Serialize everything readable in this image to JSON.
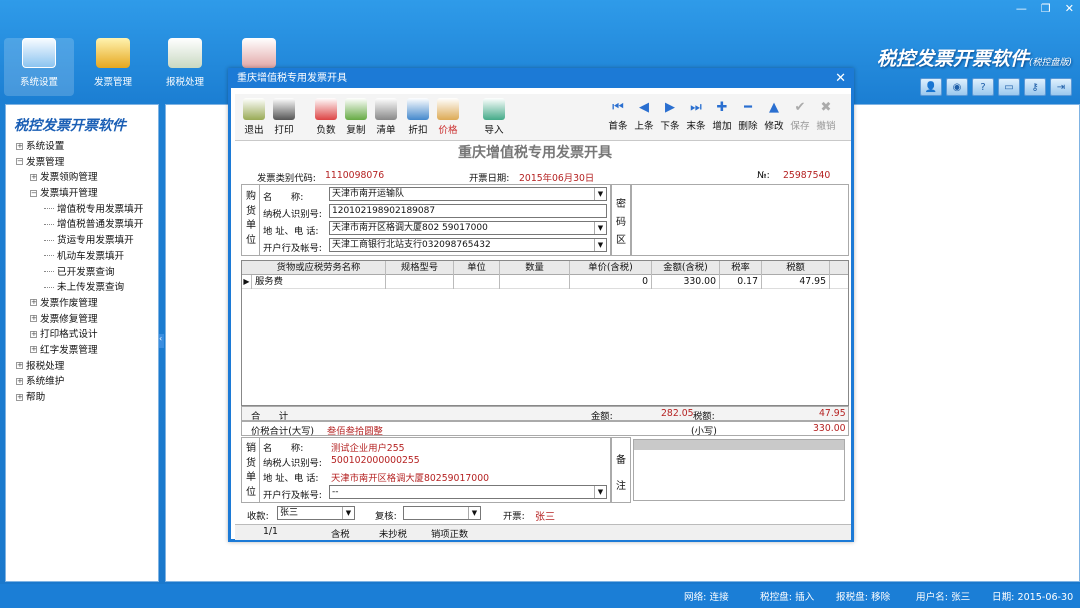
{
  "top": {
    "tools": [
      {
        "label": "系统设置",
        "active": true
      },
      {
        "label": "发票管理"
      },
      {
        "label": "报税处理"
      }
    ],
    "brand": "税控发票开票软件",
    "brand_sub": "(税控盘版)"
  },
  "sidebar": {
    "title": "税控发票开票软件",
    "tree": [
      {
        "label": "系统设置",
        "lvl": 0,
        "t": "+"
      },
      {
        "label": "发票管理",
        "lvl": 0,
        "t": "-"
      },
      {
        "label": "发票领购管理",
        "lvl": 1,
        "t": "+"
      },
      {
        "label": "发票填开管理",
        "lvl": 1,
        "t": "-"
      },
      {
        "label": "增值税专用发票填开",
        "lvl": 2
      },
      {
        "label": "增值税普通发票填开",
        "lvl": 2
      },
      {
        "label": "货运专用发票填开",
        "lvl": 2
      },
      {
        "label": "机动车发票填开",
        "lvl": 2
      },
      {
        "label": "已开发票查询",
        "lvl": 2
      },
      {
        "label": "未上传发票查询",
        "lvl": 2
      },
      {
        "label": "发票作废管理",
        "lvl": 1,
        "t": "+"
      },
      {
        "label": "发票修复管理",
        "lvl": 1,
        "t": "+"
      },
      {
        "label": "打印格式设计",
        "lvl": 1,
        "t": "+"
      },
      {
        "label": "红字发票管理",
        "lvl": 1,
        "t": "+"
      },
      {
        "label": "报税处理",
        "lvl": 0,
        "t": "+"
      },
      {
        "label": "系统维护",
        "lvl": 0,
        "t": "+"
      },
      {
        "label": "帮助",
        "lvl": 0,
        "t": "+"
      }
    ]
  },
  "dialog": {
    "title": "重庆增值税专用发票开具",
    "toolbar_left": [
      "退出",
      "打印",
      "负数",
      "复制",
      "清单",
      "折扣",
      "价格",
      "导入"
    ],
    "toolbar_right": [
      "首条",
      "上条",
      "下条",
      "末条",
      "增加",
      "删除",
      "修改",
      "保存",
      "撤销"
    ],
    "form_title": "重庆增值税专用发票开具",
    "code_label": "发票类别代码:",
    "code": "1110098076",
    "date_label": "开票日期:",
    "date": "2015年06月30日",
    "no_label": "№:",
    "no": "25987540",
    "buyer_label": "购货单位",
    "buyer": {
      "name_label": "名　　称:",
      "name": "天津市南开运输队",
      "tax_label": "纳税人识别号:",
      "tax": "120102198902189087",
      "addr_label": "地 址、电 话:",
      "addr": "天津市南开区格调大厦802  59017000",
      "bank_label": "开户行及帐号:",
      "bank": "天津工商银行北站支行032098765432"
    },
    "secret_label": "密码区",
    "grid": {
      "headers": [
        "货物或应税劳务名称",
        "规格型号",
        "单位",
        "数量",
        "单价(含税)",
        "金额(含税)",
        "税率",
        "税额"
      ],
      "row": [
        "服务费",
        "",
        "",
        "",
        "0",
        "330.00",
        "0.17",
        "47.95"
      ]
    },
    "total_label": "合　　计",
    "amount_label": "金额:",
    "amount": "282.05",
    "tax_amt_label": "税额:",
    "tax_amt": "47.95",
    "sum_label": "价税合计(大写)",
    "sum_big": "叁佰叁拾圆整",
    "small_label": "(小写)",
    "sum_small": "330.00",
    "seller_label": "销货单位",
    "seller": {
      "name_label": "名　　称:",
      "name": "测试企业用户255",
      "tax_label": "纳税人识别号:",
      "tax": "500102000000255",
      "addr_label": "地 址、电 话:",
      "addr": "天津市南开区格调大厦80259017000",
      "bank_label": "开户行及帐号:",
      "bank": "--"
    },
    "remark_label": "备注",
    "payee_label": "收款:",
    "payee": "张三",
    "check_label": "复核:",
    "check": "",
    "drawer_label": "开票:",
    "drawer": "张三",
    "tabs": [
      "1/1",
      "含税",
      "未抄税",
      "销项正数"
    ]
  },
  "status": {
    "net": "网络: 连接",
    "disk": "税控盘: 插入",
    "report": "报税盘: 移除",
    "user": "用户名: 张三",
    "date": "日期: 2015-06-30"
  }
}
